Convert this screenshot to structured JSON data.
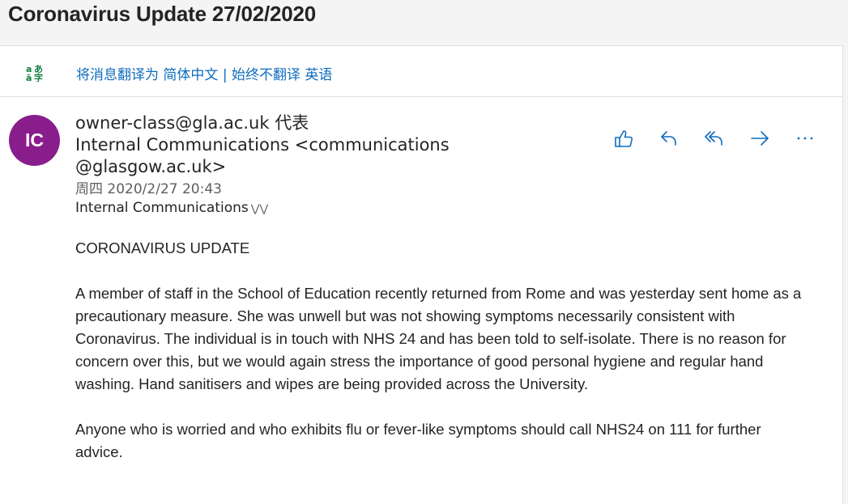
{
  "subject": "Coronavirus Update 27/02/2020",
  "translate": {
    "link_translate": "将消息翻译为 简体中文",
    "separator": "|",
    "link_never": "始终不翻译 英语"
  },
  "sender": {
    "avatar_initials": "IC",
    "on_behalf": "owner-class@gla.ac.uk 代表",
    "from": "Internal Communications <communications @glasgow.ac.uk>",
    "date": "周四 2020/2/27 20:43",
    "to": "Internal Communications"
  },
  "actions": {
    "like": "like-icon",
    "reply": "reply-icon",
    "reply_all": "reply-all-icon",
    "forward": "forward-icon",
    "more": "more-icon"
  },
  "body": {
    "heading": "CORONAVIRUS UPDATE",
    "para1": "A member of staff in the School of Education recently returned from Rome and was yesterday sent home as a precautionary measure. She was unwell but was not showing symptoms necessarily consistent with Coronavirus. The individual is in touch with NHS 24 and has been told to self-isolate. There is no reason for concern over this, but we would again stress the importance of good personal hygiene and regular hand washing. Hand sanitisers and wipes are being provided across the University.",
    "para2": "Anyone who is worried and who exhibits flu or fever-like symptoms should call NHS24 on 111 for further advice."
  },
  "colors": {
    "accent": "#0f6cbd",
    "avatar": "#8a1d8c",
    "translate_icon": "#107c41"
  }
}
